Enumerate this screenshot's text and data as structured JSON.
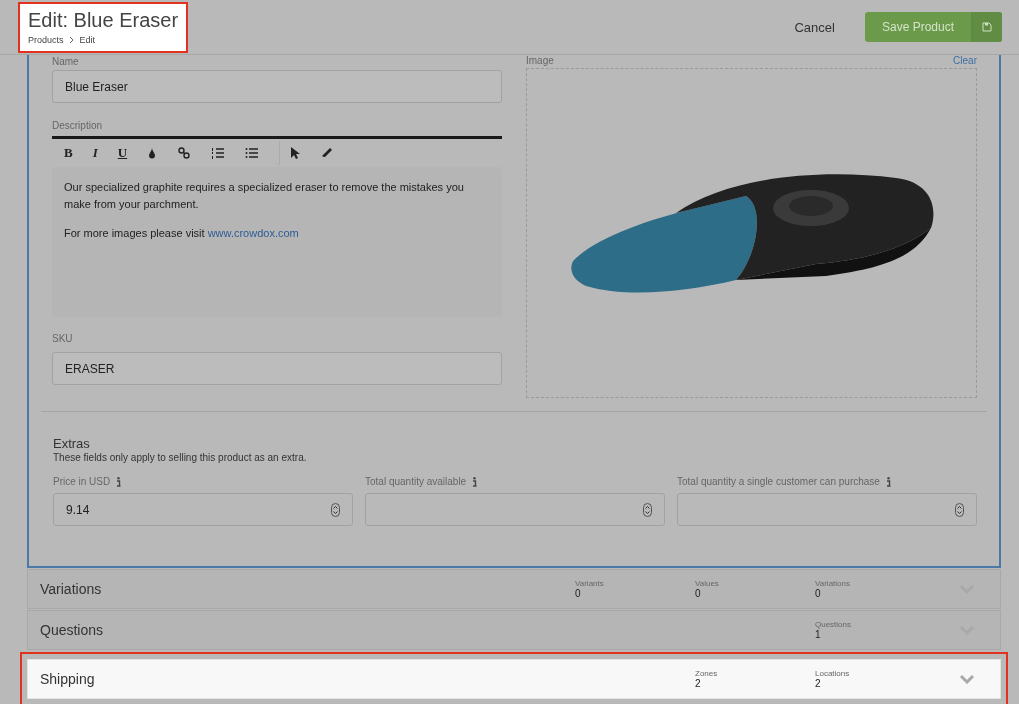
{
  "header": {
    "title": "Edit: Blue Eraser",
    "highlighted": true,
    "breadcrumbs": [
      "Products",
      "Edit"
    ],
    "cancel": "Cancel",
    "save": "Save Product"
  },
  "form": {
    "name": {
      "label": "Name",
      "value": "Blue Eraser"
    },
    "description": {
      "label": "Description",
      "format_buttons": [
        "B",
        "I",
        "U"
      ],
      "paragraphs": [
        {
          "text": "Our specialized graphite requires a specialized eraser to remove the mistakes you make from your parchment."
        },
        {
          "text": "For more images please visit ",
          "link": "www.crowdox.com"
        }
      ]
    },
    "sku": {
      "label": "SKU",
      "value": "ERASER"
    },
    "image": {
      "label": "Image",
      "clear": "Clear"
    }
  },
  "extras": {
    "title": "Extras",
    "subtitle": "These fields only apply to selling this product as an extra.",
    "fields": [
      {
        "label": "Price in USD",
        "value": "9.14"
      },
      {
        "label": "Total quantity available"
      },
      {
        "label": "Total quantity a single customer can purchase"
      }
    ]
  },
  "sections": [
    {
      "title": "Variations",
      "highlighted": false,
      "stats": [
        {
          "label": "Variants",
          "value": "0"
        },
        {
          "label": "Values",
          "value": "0"
        },
        {
          "label": "Variations",
          "value": "0"
        }
      ]
    },
    {
      "title": "Questions",
      "highlighted": false,
      "stats": [
        {
          "label": "Questions",
          "value": "1"
        }
      ]
    },
    {
      "title": "Shipping",
      "highlighted": true,
      "stats": [
        {
          "label": "Zones",
          "value": "2"
        },
        {
          "label": "Locations",
          "value": "2"
        }
      ]
    }
  ]
}
